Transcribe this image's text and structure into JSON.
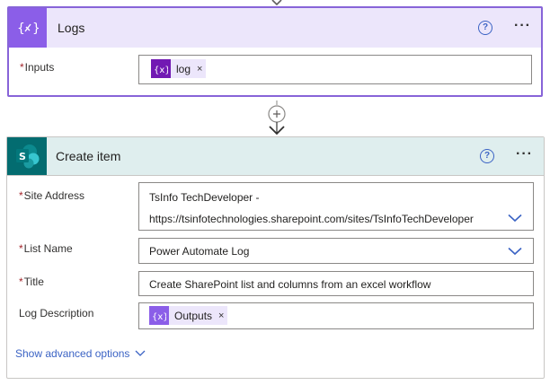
{
  "logs_card": {
    "title": "Logs",
    "help_glyph": "?",
    "more_glyph": "···",
    "inputs": {
      "label": "Inputs",
      "required_mark": "*",
      "token": {
        "text": "log",
        "remove_glyph": "×",
        "icon": "variable-icon"
      }
    },
    "icon": "variable-braces-icon",
    "accent_color": "#8b5ee8"
  },
  "create_item_card": {
    "title": "Create item",
    "icon_letter": "S",
    "help_glyph": "?",
    "more_glyph": "···",
    "accent_color": "#036c70",
    "site_address": {
      "label": "Site Address",
      "required_mark": "*",
      "line1": "TsInfo TechDeveloper -",
      "line2": "https://tsinfotechnologies.sharepoint.com/sites/TsInfoTechDeveloper"
    },
    "list_name": {
      "label": "List Name",
      "required_mark": "*",
      "value": "Power Automate Log"
    },
    "title_field": {
      "label": "Title",
      "required_mark": "*",
      "value": "Create SharePoint list and columns from an excel workflow"
    },
    "log_description": {
      "label": "Log Description",
      "token": {
        "text": "Outputs",
        "remove_glyph": "×",
        "icon": "variable-icon"
      }
    },
    "advanced_link": "Show advanced options"
  },
  "connector": {
    "add_icon": "plus-circle-icon",
    "arrow_icon": "arrow-down-icon"
  }
}
